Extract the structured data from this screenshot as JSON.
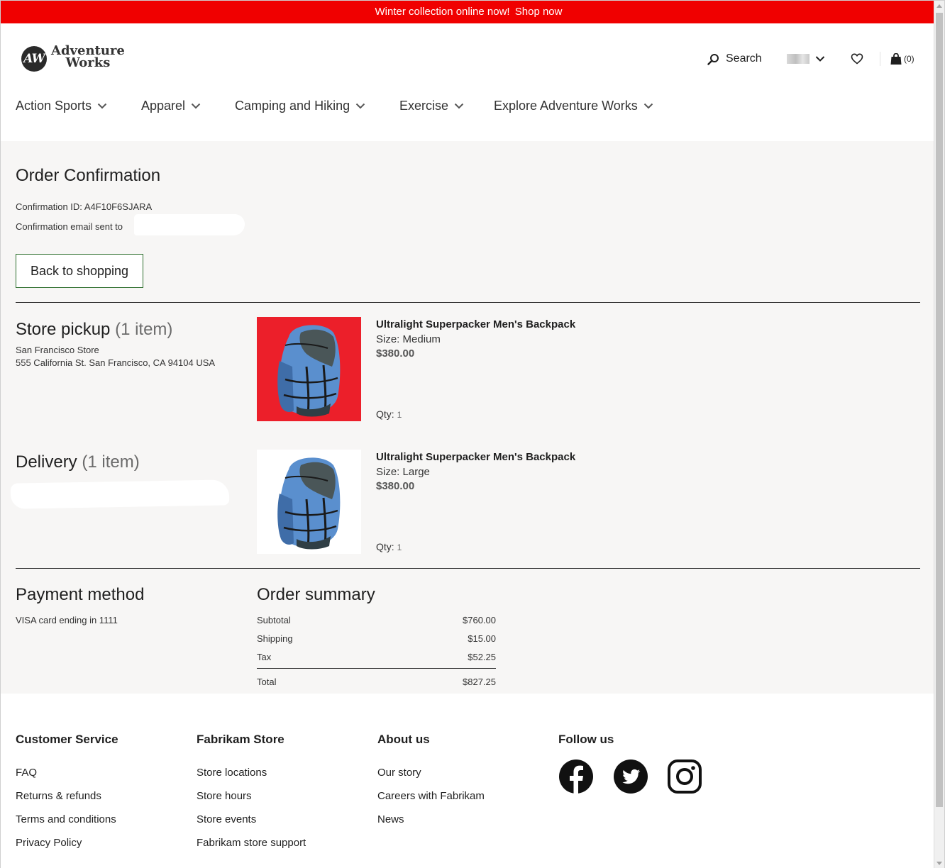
{
  "promo": {
    "text": "Winter collection online now!",
    "link": "Shop now"
  },
  "header": {
    "logo_text_1": "Adventure",
    "logo_text_2": "Works",
    "logo_monogram": "AW",
    "search_label": "Search",
    "cart_count": "(0)"
  },
  "nav": {
    "items": [
      {
        "label": "Action Sports"
      },
      {
        "label": "Apparel"
      },
      {
        "label": "Camping and Hiking"
      },
      {
        "label": "Exercise"
      },
      {
        "label": "Explore Adventure Works"
      }
    ]
  },
  "order": {
    "title": "Order Confirmation",
    "confirmation_id": "Confirmation ID: A4F10F6SJARA",
    "email_sent": "Confirmation email sent to",
    "back_button": "Back to shopping"
  },
  "pickup": {
    "title": "Store pickup",
    "count": "(1 item)",
    "store_name": "San Francisco Store",
    "store_address": "555 California St. San Francisco, CA 94104 USA",
    "product": {
      "name": "Ultralight Superpacker Men's Backpack",
      "size": "Size: Medium",
      "price": "$380.00",
      "qty_label": "Qty:",
      "qty": "1"
    }
  },
  "delivery": {
    "title": "Delivery",
    "count": "(1 item)",
    "product": {
      "name": "Ultralight Superpacker Men's Backpack",
      "size": "Size: Large",
      "price": "$380.00",
      "qty_label": "Qty:",
      "qty": "1"
    }
  },
  "payment": {
    "title": "Payment method",
    "line": "VISA card ending in 1111"
  },
  "summary": {
    "title": "Order summary",
    "subtotal_label": "Subtotal",
    "subtotal": "$760.00",
    "shipping_label": "Shipping",
    "shipping": "$15.00",
    "tax_label": "Tax",
    "tax": "$52.25",
    "total_label": "Total",
    "total": "$827.25"
  },
  "footer": {
    "customer_service": {
      "heading": "Customer Service",
      "links": [
        "FAQ",
        "Returns & refunds",
        "Terms and conditions",
        "Privacy Policy"
      ]
    },
    "store": {
      "heading": "Fabrikam Store",
      "links": [
        "Store locations",
        "Store hours",
        "Store events",
        "Fabrikam store support"
      ]
    },
    "about": {
      "heading": "About us",
      "links": [
        "Our story",
        "Careers with Fabrikam",
        "News"
      ]
    },
    "follow": {
      "heading": "Follow us",
      "icons": [
        "facebook-icon",
        "twitter-icon",
        "instagram-icon"
      ]
    }
  },
  "colors": {
    "promo_bg": "#f00000",
    "main_bg": "#f7f6f5",
    "button_border": "#2c6e2c",
    "product_bg_red": "#ec1f2a"
  }
}
